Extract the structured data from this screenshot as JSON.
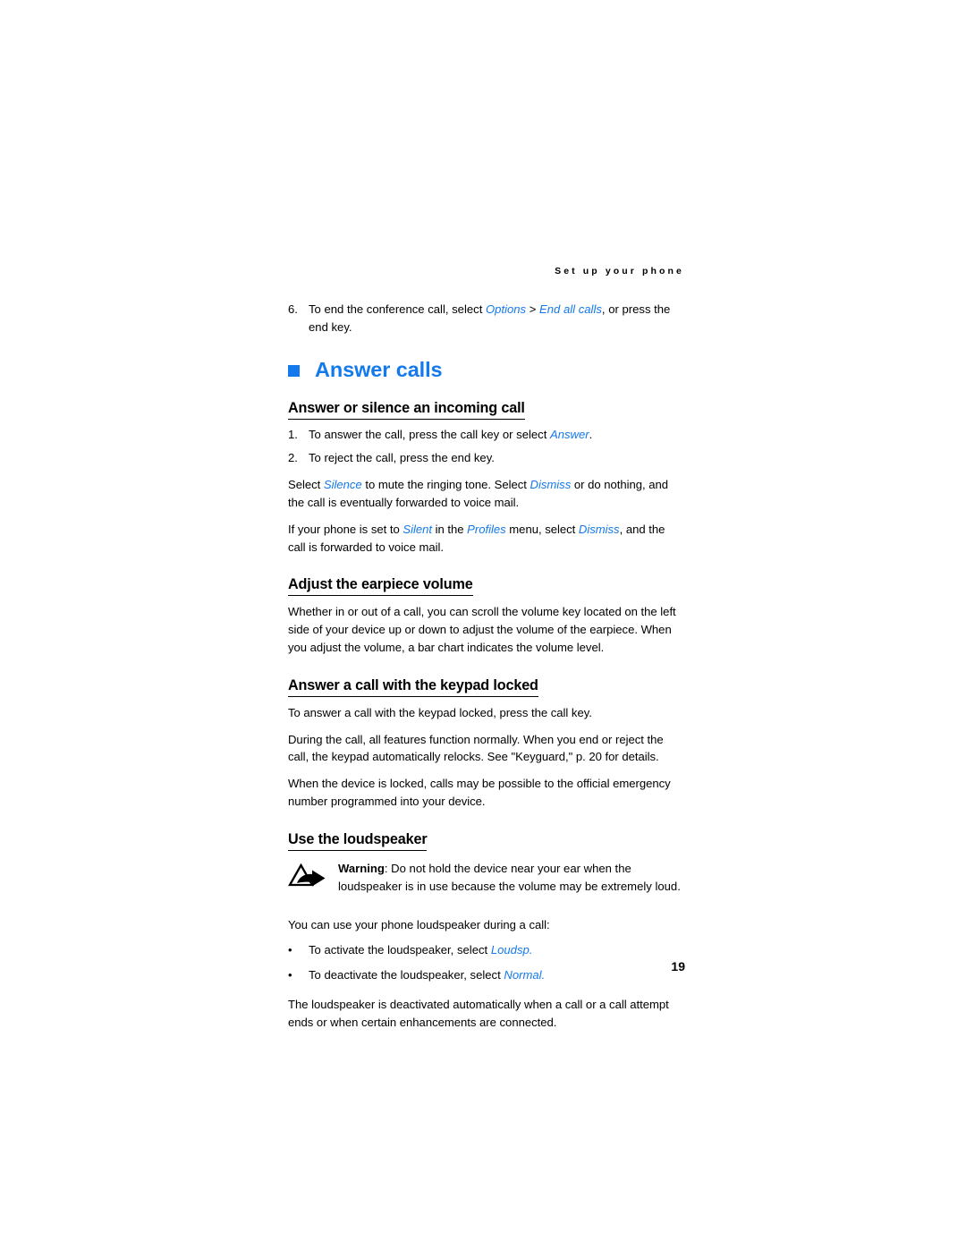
{
  "page": {
    "running_head": "Set up your phone",
    "page_number": "19",
    "accent_color": "#1379ec",
    "text_color": "#000000",
    "background_color": "#ffffff"
  },
  "step6": {
    "number": "6.",
    "text_part1": "To end the conference call, select ",
    "link1": "Options",
    "sep": " > ",
    "link2": "End all calls",
    "text_part2": ", or press the end key."
  },
  "chapter": {
    "icon": "blue-square-bullet",
    "title": "Answer calls"
  },
  "sections": {
    "answer_or_silence": {
      "heading": "Answer or silence an incoming call",
      "step1": {
        "number": "1.",
        "text_part1": "To answer the call, press the call key or select ",
        "link1": "Answer",
        "text_part2": "."
      },
      "step2": {
        "number": "2.",
        "text": "To reject the call, press the end key."
      },
      "para1_a": "Select ",
      "para1_link1": "Silence",
      "para1_b": " to mute the ringing tone. Select ",
      "para1_link2": "Dismiss",
      "para1_c": " or do nothing, and the call is eventually forwarded to voice mail.",
      "para2_a": "If your phone is set to ",
      "para2_link1": "Silent",
      "para2_b": " in the ",
      "para2_link2": "Profiles",
      "para2_c": " menu, select ",
      "para2_link3": "Dismiss",
      "para2_d": ", and the call is forwarded to voice mail."
    },
    "adjust_volume": {
      "heading": "Adjust the earpiece volume",
      "para": "Whether in or out of a call, you can scroll the volume key located on the left side of your device up or down to adjust the volume of the earpiece. When you adjust the volume, a bar chart indicates the volume level."
    },
    "keypad_locked": {
      "heading": "Answer a call with the keypad locked",
      "para1": "To answer a call with the keypad locked, press the call key.",
      "para2": "During the call, all features function normally. When you end or reject the call, the keypad automatically relocks. See \"Keyguard,\" p. 20 for details.",
      "para3": "When the device is locked, calls may be possible to the official emergency number programmed into your device."
    },
    "loudspeaker": {
      "heading": "Use the loudspeaker",
      "warning_icon": "warning-triangle-arrow-icon",
      "warning_label": "Warning",
      "warning_text": ": Do not hold the device near your ear when the loudspeaker is in use because the volume may be extremely loud.",
      "intro": "You can use your phone loudspeaker during a call:",
      "bullets": [
        {
          "marker": "•",
          "text_part1": "To activate the loudspeaker, select ",
          "link": "Loudsp."
        },
        {
          "marker": "•",
          "text_part1": "To deactivate the loudspeaker, select ",
          "link": "Normal."
        }
      ],
      "closing": "The loudspeaker is deactivated automatically when a call or a call attempt ends or when certain enhancements are connected."
    }
  }
}
